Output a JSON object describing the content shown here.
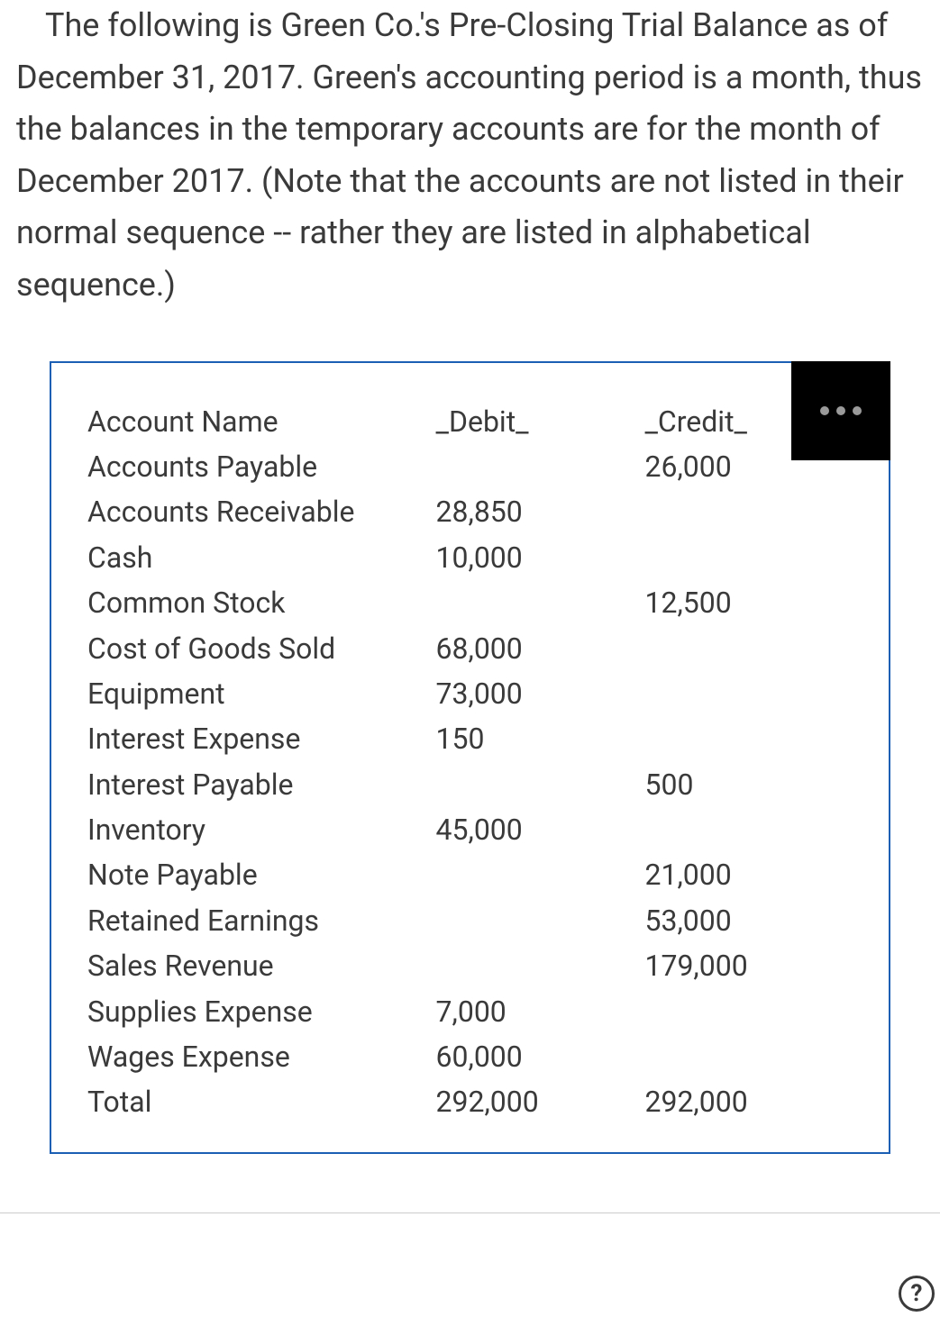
{
  "intro": "The following is Green Co.'s Pre-Closing Trial Balance as of December 31, 2017.   Green's accounting period is a month, thus the balances in the temporary accounts are for    the month of December 2017. (Note that the accounts are not listed in their normal sequence -- rather they are listed in alphabetical sequence.)",
  "table": {
    "headers": {
      "name": "Account Name",
      "debit": "_Debit_",
      "credit": "_Credit_"
    },
    "rows": [
      {
        "name": "Accounts Payable",
        "debit": "",
        "credit": "26,000"
      },
      {
        "name": "Accounts Receivable",
        "debit": "28,850",
        "credit": ""
      },
      {
        "name": "Cash",
        "debit": "10,000",
        "credit": ""
      },
      {
        "name": "Common Stock",
        "debit": "",
        "credit": "12,500"
      },
      {
        "name": "Cost of Goods Sold",
        "debit": "68,000",
        "credit": ""
      },
      {
        "name": "Equipment",
        "debit": "73,000",
        "credit": ""
      },
      {
        "name": "Interest Expense",
        "debit": "150",
        "credit": ""
      },
      {
        "name": "Interest Payable",
        "debit": "",
        "credit": "500"
      },
      {
        "name": "Inventory",
        "debit": "45,000",
        "credit": ""
      },
      {
        "name": "Note Payable",
        "debit": "",
        "credit": "21,000"
      },
      {
        "name": "Retained Earnings",
        "debit": "",
        "credit": "53,000"
      },
      {
        "name": "Sales Revenue",
        "debit": "",
        "credit": "179,000"
      },
      {
        "name": "Supplies Expense",
        "debit": "7,000",
        "credit": ""
      },
      {
        "name": "Wages Expense",
        "debit": "60,000",
        "credit": ""
      },
      {
        "name": "Total",
        "debit": "292,000",
        "credit": "292,000"
      }
    ]
  },
  "help_symbol": "?"
}
